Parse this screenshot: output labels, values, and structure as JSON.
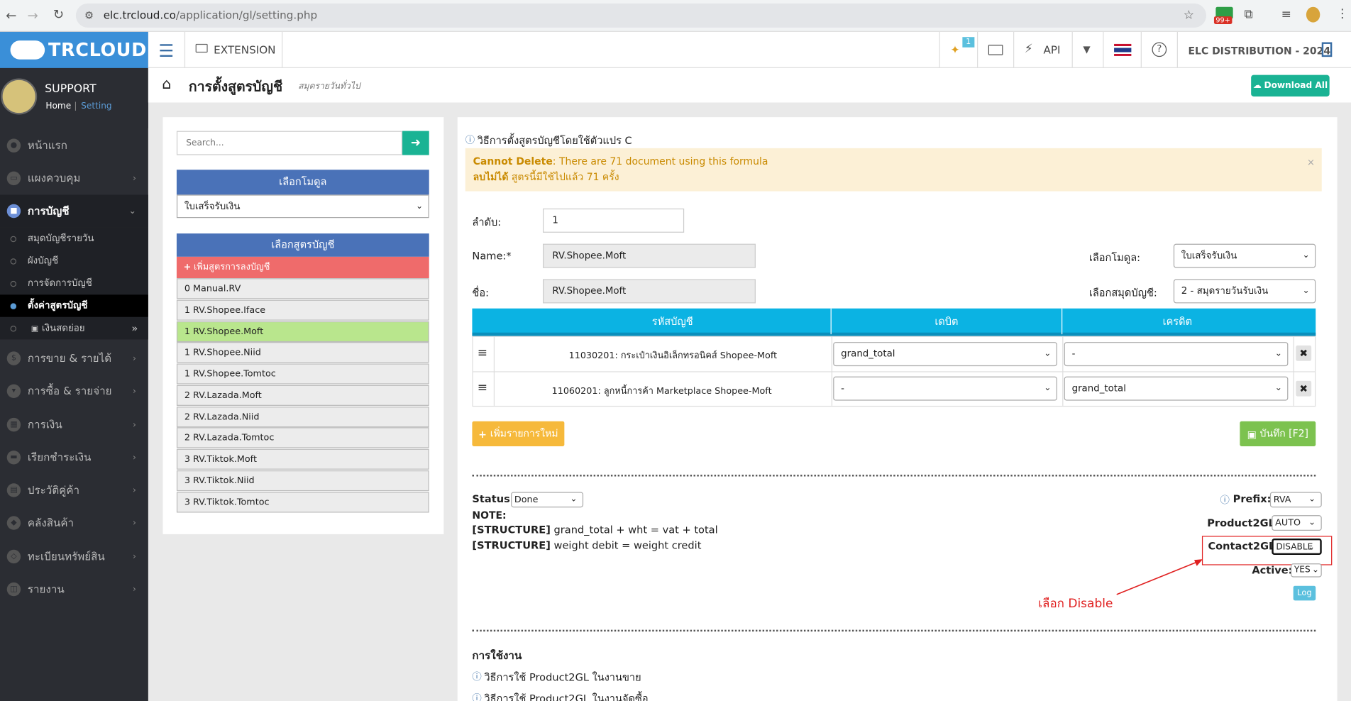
{
  "browser": {
    "url_host": "elc.trcloud.co",
    "url_path": "/application/gl/setting.php",
    "badge": "99+"
  },
  "sidebar": {
    "brand": "TRCLOUD",
    "user": "SUPPORT",
    "crumb_home": "Home",
    "crumb_sep": "|",
    "crumb_setting": "Setting",
    "items": [
      {
        "label": "หน้าแรก"
      },
      {
        "label": "แผงควบคุม"
      },
      {
        "label": "การบัญชี"
      },
      {
        "label": "การขาย & รายได้"
      },
      {
        "label": "การซื้อ & รายจ่าย"
      },
      {
        "label": "การเงิน"
      },
      {
        "label": "เรียกชำระเงิน"
      },
      {
        "label": "ประวัติคู่ค้า"
      },
      {
        "label": "คลังสินค้า"
      },
      {
        "label": "ทะเบียนทรัพย์สิน"
      },
      {
        "label": "รายงาน"
      }
    ],
    "subitems": [
      {
        "label": "สมุดบัญชีรายวัน"
      },
      {
        "label": "ผังบัญชี"
      },
      {
        "label": "การจัดการบัญชี"
      },
      {
        "label": "ตั้งค่าสูตรบัญชี"
      },
      {
        "label": "เงินสดย่อย"
      }
    ]
  },
  "topbar": {
    "extension": "EXTENSION",
    "notif_count": "1",
    "api": "API",
    "company": "ELC DISTRIBUTION - 2024"
  },
  "header": {
    "title": "การตั้งสูตรบัญชี",
    "subtitle": "สมุดรายวันทั่วไป",
    "download": "Download All"
  },
  "left": {
    "search_placeholder": "Search...",
    "module_header": "เลือกโมดูล",
    "module_value": "ใบเสร็จรับเงิน",
    "formula_header": "เลือกสูตรบัญชี",
    "add_formula": "เพิ่มสูตรการลงบัญชี",
    "formulas": [
      "0 Manual.RV",
      "1 RV.Shopee.Iface",
      "1 RV.Shopee.Moft",
      "1 RV.Shopee.Niid",
      "1 RV.Shopee.Tomtoc",
      "2 RV.Lazada.Moft",
      "2 RV.Lazada.Niid",
      "2 RV.Lazada.Tomtoc",
      "3 RV.Tiktok.Moft",
      "3 RV.Tiktok.Niid",
      "3 RV.Tiktok.Tomtoc"
    ]
  },
  "right": {
    "info_link": "วิธีการตั้งสูตรบัญชีโดยใช้ตัวแปร C",
    "alert_en_bold": "Cannot Delete",
    "alert_en": ": There are 71 document using this formula",
    "alert_th_bold": "ลบไม่ได้",
    "alert_th": " สูตรนี้มีใช้ไปแล้ว 71 ครั้ง",
    "order_label": "ลำดับ:",
    "order_value": "1",
    "name_label": "Name:*",
    "name_value": "RV.Shopee.Moft",
    "name_th_label": "ชื่อ:",
    "name_th_value": "RV.Shopee.Moft",
    "module_label": "เลือกโมดูล:",
    "module_value": "ใบเสร็จรับเงิน",
    "journal_label": "เลือกสมุดบัญชี:",
    "journal_value": "2 - สมุดรายวันรับเงิน",
    "table_headers": {
      "code": "รหัสบัญชี",
      "debit": "เดบิต",
      "credit": "เครดิต"
    },
    "rows": [
      {
        "account": "11030201: กระเป๋าเงินอิเล็กทรอนิคส์ Shopee-Moft",
        "debit": "grand_total",
        "credit": "-"
      },
      {
        "account": "11060201: ลูกหนี้การค้า Marketplace Shopee-Moft",
        "debit": "-",
        "credit": "grand_total"
      }
    ],
    "add_row": "เพิ่มรายการใหม่",
    "save": "บันทึก [F2]",
    "status_label": "Status:",
    "status_value": "Done",
    "note_label": "NOTE:",
    "structure_tag": "[STRUCTURE]",
    "structure1": " grand_total + wht = vat + total",
    "structure2": " weight debit = weight credit",
    "prefix_label": "Prefix:",
    "prefix_value": "RVA",
    "product2gl_label": "Product2GL:",
    "product2gl_value": "AUTO",
    "contact2gl_label": "Contact2GL:",
    "contact2gl_value": "DISABLE",
    "active_label": "Active:",
    "active_value": "YES",
    "log": "Log",
    "annotation": "เลือก Disable",
    "usage_title": "การใช้งาน",
    "usage1": "วิธีการใช้ Product2GL ในงานขาย",
    "usage2": "วิธีการใช้ Product2GL ในงานจัดซื้อ"
  },
  "colors": {
    "brand_blue": "#3a8fd8",
    "teal": "#1ab394",
    "table_head": "#0bb3e3",
    "panel_head": "#4a72b8",
    "add_red": "#ef6b6b",
    "selected_green": "#b9e68d",
    "warning": "#fcf0d6",
    "orange": "#f6b93b",
    "green": "#7cc24f",
    "annotation_red": "#e02020"
  }
}
